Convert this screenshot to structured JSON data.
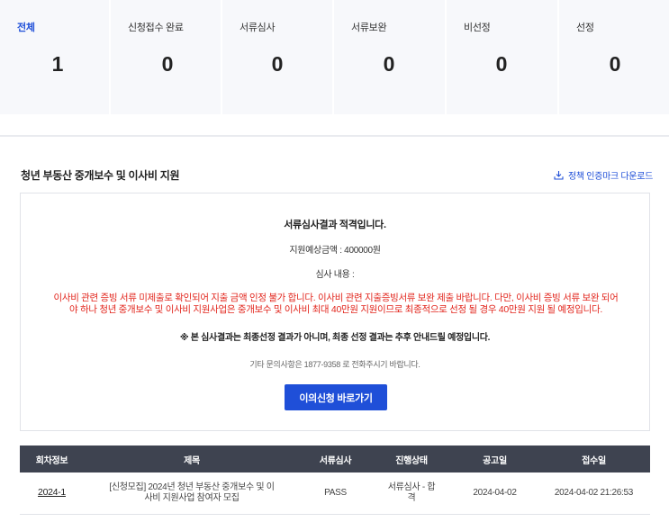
{
  "summary": {
    "items": [
      {
        "label": "전체",
        "count": "1",
        "active": true
      },
      {
        "label": "신청접수 완료",
        "count": "0"
      },
      {
        "label": "서류심사",
        "count": "0"
      },
      {
        "label": "서류보완",
        "count": "0"
      },
      {
        "label": "비선정",
        "count": "0"
      },
      {
        "label": "선정",
        "count": "0"
      }
    ]
  },
  "program": {
    "title": "청년 부동산 중개보수 및 이사비 지원",
    "download_label": "정책 인증마크 다운로드",
    "download_icon": "download-icon"
  },
  "result": {
    "title": "서류심사결과 적격입니다.",
    "amount": "지원예상금액 : 400000원",
    "review": "심사 내용 :",
    "reason_line1": "이사비 관련 증빙 서류 미제출로 확인되어 지출 금액 인정 불가 합니다. 이사비 관련 지출증빙서류 보완 제출 바랍니다. 다만, 이사비 증빙 서류 보완 되어",
    "reason_line2": "야 하나 청년 중개보수 및 이사비 지원사업은 중개보수 및 이사비 최대 40만원 지원이므로 최종적으로 선정 될 경우 40만원 지원 될 예정입니다.",
    "notice": "※ 본 심사결과는 최종선정 결과가 아니며, 최종 선정 결과는 추후 안내드릴 예정입니다.",
    "contact": "기타 문의사항은 1877-9358 로 전화주시기 바랍니다.",
    "appeal_label": "이의신청 바로가기",
    "reason_color": "#e2261d",
    "accent_color": "#1f4fd8"
  },
  "table": {
    "headers": [
      "회차정보",
      "제목",
      "서류심사",
      "진행상태",
      "공고일",
      "접수일"
    ],
    "rows": [
      {
        "round": "2024-1",
        "title_line1": "[신청모집] 2024년 청년 부동산 중개보수 및 이",
        "title_line2": "사비 지원사업 참여자 모집",
        "review": "PASS",
        "status_line1": "서류심사 - 합",
        "status_line2": "격",
        "notice_date": "2024-04-02",
        "received": "2024-04-02 21:26:53"
      }
    ]
  }
}
